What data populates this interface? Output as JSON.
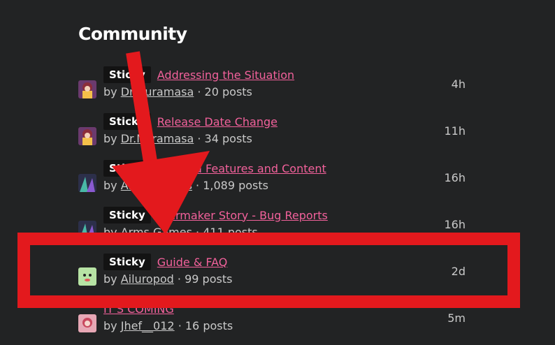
{
  "heading": "Community",
  "threads": [
    {
      "badge": "Sticky",
      "title": "Addressing the Situation",
      "by": "by",
      "author": "Dr.Nuramasa",
      "sep": "·",
      "posts": "20 posts",
      "time": "4h"
    },
    {
      "badge": "Sticky",
      "title": "Release Date Change",
      "by": "by",
      "author": "Dr.Nuramasa",
      "sep": "·",
      "posts": "34 posts",
      "time": "11h"
    },
    {
      "badge": "Sticky",
      "title": "Planned Features and Content",
      "by": "by",
      "author": "Arms Games",
      "sep": "·",
      "posts": "1,089 posts",
      "time": "16h"
    },
    {
      "badge": "Sticky",
      "title": "Starmaker Story - Bug Reports",
      "by": "by",
      "author": "Arms Games",
      "sep": "·",
      "posts": "411 posts",
      "time": "16h"
    },
    {
      "badge": "Sticky",
      "title": "Guide & FAQ",
      "by": "by",
      "author": "Ailuropod",
      "sep": "·",
      "posts": "99 posts",
      "time": "2d"
    },
    {
      "badge": "",
      "title": "IT'S COMING",
      "by": "by",
      "author": "Jhef__012",
      "sep": "·",
      "posts": "16 posts",
      "time": "5m"
    }
  ],
  "colors": {
    "background": "#222324",
    "link": "#f2619b",
    "annotation": "#e3191d"
  }
}
